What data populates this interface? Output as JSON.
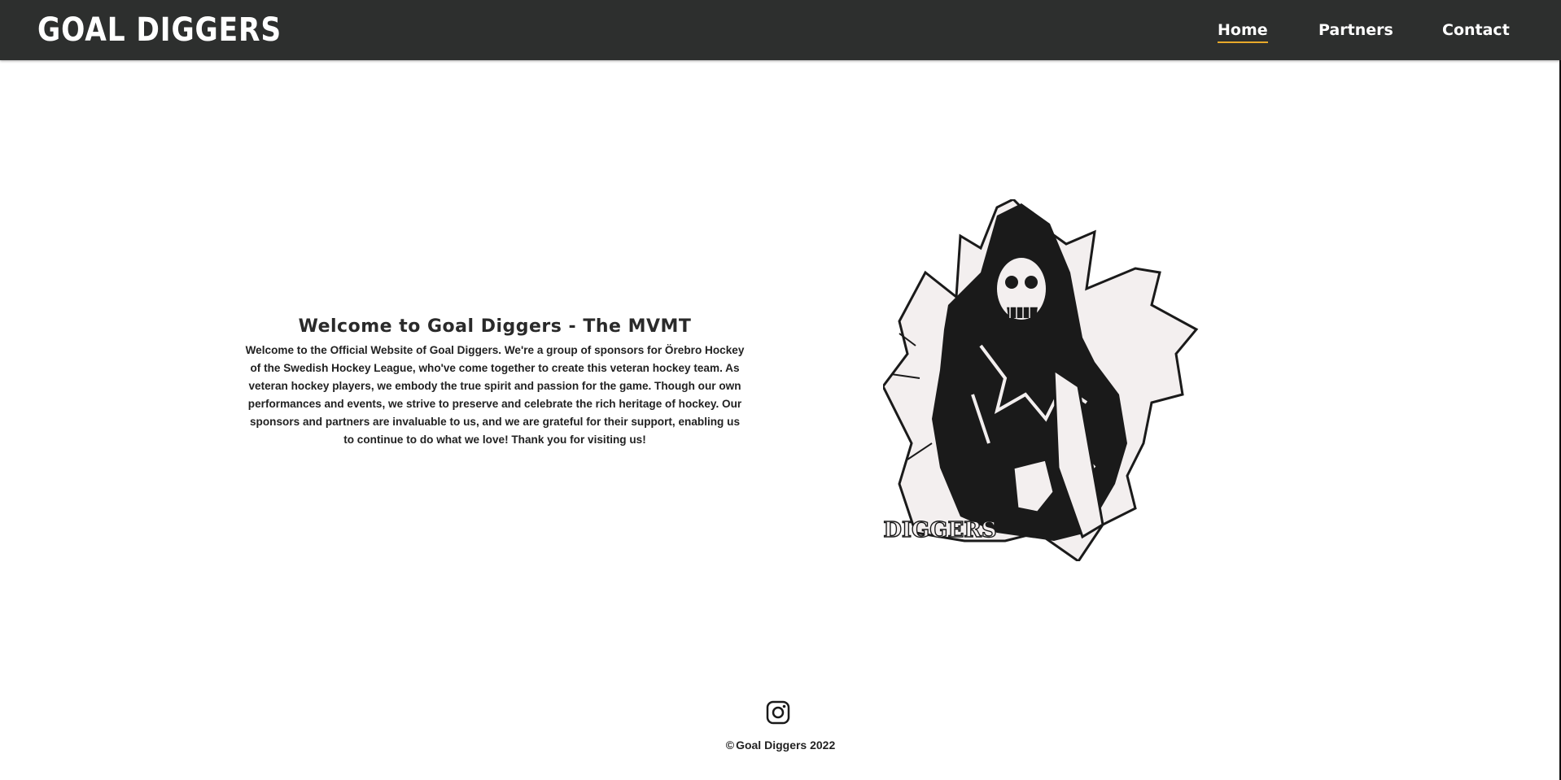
{
  "header": {
    "brand": "GOAL DIGGERS",
    "nav": [
      {
        "label": "Home",
        "active": true
      },
      {
        "label": "Partners",
        "active": false
      },
      {
        "label": "Contact",
        "active": false
      }
    ],
    "accent_color": "#e7a92a",
    "background_color": "#2d2f2e"
  },
  "main": {
    "title": "Welcome to Goal Diggers - The MVMT",
    "body": "Welcome to the Official Website of Goal Diggers. We're a group of sponsors for Örebro Hockey of the Swedish Hockey League, who've come together to create this veteran hockey team. As veteran hockey players, we embody the true spirit and passion for the game. Though our own performances and events, we strive to preserve and celebrate the rich heritage of hockey. Our sponsors and partners are invaluable to us, and we are grateful for their support, enabling us to continue to do what we love! Thank you for visiting us!",
    "mascot_icon": "grim-reaper-hockey-mascot",
    "mascot_text": "DIGGERS"
  },
  "footer": {
    "social_icon": "instagram-icon",
    "copyright_symbol": "©",
    "copyright_text": "Goal Diggers 2022"
  }
}
